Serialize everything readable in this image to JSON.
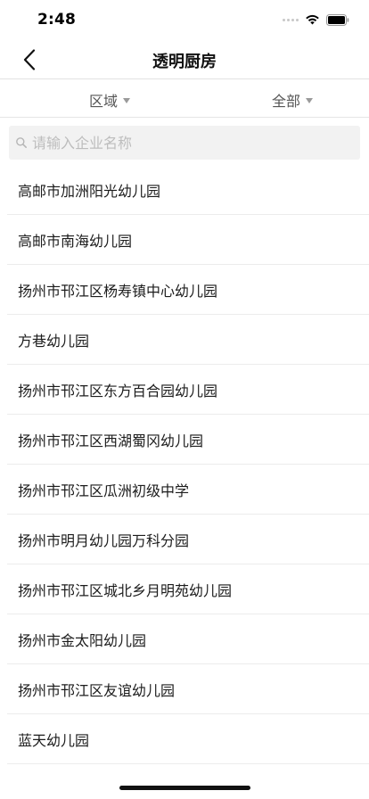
{
  "status": {
    "time": "2:48"
  },
  "nav": {
    "title": "透明厨房",
    "back_icon": "chevron-left-icon"
  },
  "filters": {
    "region_label": "区域",
    "all_label": "全部"
  },
  "search": {
    "placeholder": "请输入企业名称",
    "value": ""
  },
  "list": {
    "items": [
      "高邮市加洲阳光幼儿园",
      "高邮市南海幼儿园",
      "扬州市邗江区杨寿镇中心幼儿园",
      "方巷幼儿园",
      "扬州市邗江区东方百合园幼儿园",
      "扬州市邗江区西湖蜀冈幼儿园",
      "扬州市邗江区瓜洲初级中学",
      "扬州市明月幼儿园万科分园",
      "扬州市邗江区城北乡月明苑幼儿园",
      "扬州市金太阳幼儿园",
      "扬州市邗江区友谊幼儿园",
      "蓝天幼儿园"
    ]
  },
  "colors": {
    "divider": "#ececec",
    "search_bg": "#f2f2f2",
    "text_primary": "#1c1c1c",
    "text_secondary": "#555555"
  }
}
